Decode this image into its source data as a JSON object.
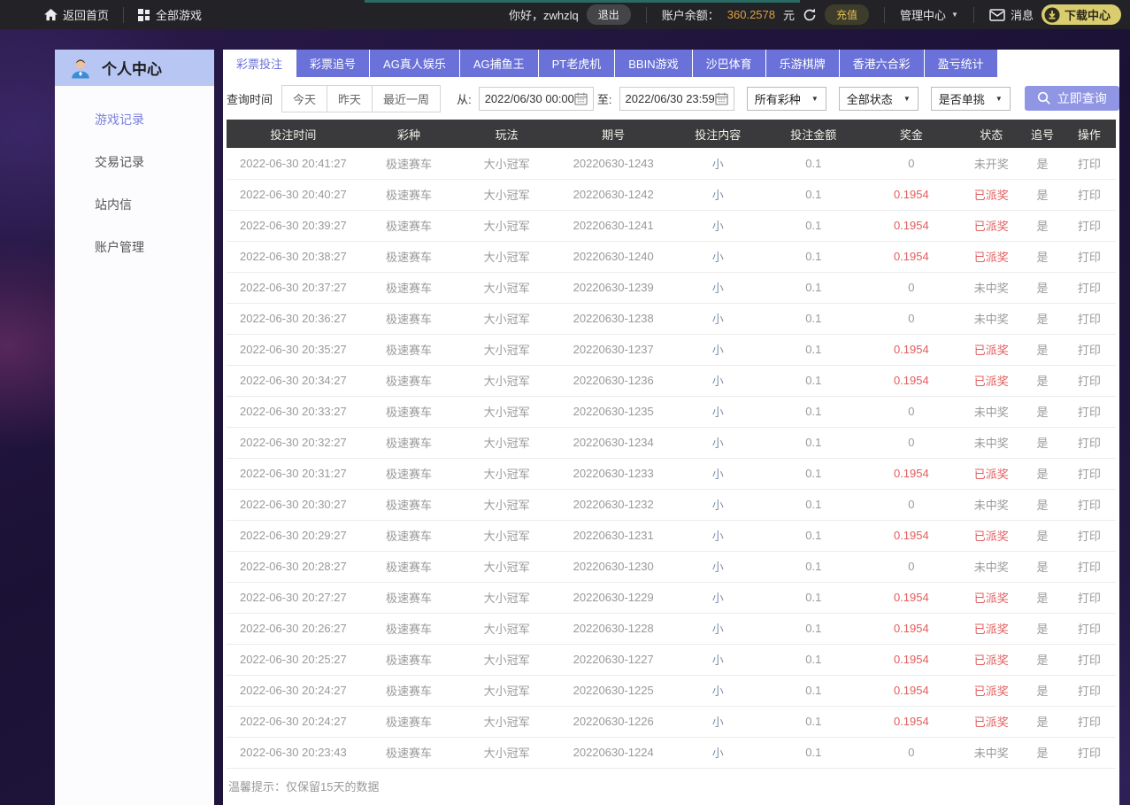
{
  "topbar": {
    "home_label": "返回首页",
    "all_games_label": "全部游戏",
    "greeting": "你好，zwhzlq",
    "logout_label": "退出",
    "balance_label": "账户余额：",
    "balance_value": "360.2578",
    "balance_unit": "元",
    "recharge_label": "充值",
    "admin_label": "管理中心",
    "messages_label": "消息",
    "download_label": "下载中心"
  },
  "sidebar": {
    "title": "个人中心",
    "items": [
      {
        "label": "游戏记录",
        "active": true
      },
      {
        "label": "交易记录",
        "active": false
      },
      {
        "label": "站内信",
        "active": false
      },
      {
        "label": "账户管理",
        "active": false
      }
    ]
  },
  "tabs": [
    {
      "label": "彩票投注",
      "active": true
    },
    {
      "label": "彩票追号",
      "active": false
    },
    {
      "label": "AG真人娱乐",
      "active": false
    },
    {
      "label": "AG捕鱼王",
      "active": false
    },
    {
      "label": "PT老虎机",
      "active": false
    },
    {
      "label": "BBIN游戏",
      "active": false
    },
    {
      "label": "沙巴体育",
      "active": false
    },
    {
      "label": "乐游棋牌",
      "active": false
    },
    {
      "label": "香港六合彩",
      "active": false
    },
    {
      "label": "盈亏统计",
      "active": false
    }
  ],
  "query": {
    "time_label": "查询时间",
    "quick_ranges": [
      "今天",
      "昨天",
      "最近一周"
    ],
    "from_label": "从:",
    "from_value": "2022/06/30 00:00",
    "to_label": "至:",
    "to_value": "2022/06/30 23:59",
    "filters": [
      "所有彩种",
      "全部状态",
      "是否单挑"
    ],
    "search_label": "立即查询"
  },
  "table": {
    "headers": [
      "投注时间",
      "彩种",
      "玩法",
      "期号",
      "投注内容",
      "投注金额",
      "奖金",
      "状态",
      "追号",
      "操作"
    ],
    "rows": [
      {
        "time": "2022-06-30 20:41:27",
        "lottery": "极速赛车",
        "play": "大小冠军",
        "issue": "20220630-1243",
        "content": "小",
        "amount": "0.1",
        "prize": "0",
        "status": "未开奖",
        "chase": "是",
        "action": "打印"
      },
      {
        "time": "2022-06-30 20:40:27",
        "lottery": "极速赛车",
        "play": "大小冠军",
        "issue": "20220630-1242",
        "content": "小",
        "amount": "0.1",
        "prize": "0.1954",
        "status": "已派奖",
        "chase": "是",
        "action": "打印"
      },
      {
        "time": "2022-06-30 20:39:27",
        "lottery": "极速赛车",
        "play": "大小冠军",
        "issue": "20220630-1241",
        "content": "小",
        "amount": "0.1",
        "prize": "0.1954",
        "status": "已派奖",
        "chase": "是",
        "action": "打印"
      },
      {
        "time": "2022-06-30 20:38:27",
        "lottery": "极速赛车",
        "play": "大小冠军",
        "issue": "20220630-1240",
        "content": "小",
        "amount": "0.1",
        "prize": "0.1954",
        "status": "已派奖",
        "chase": "是",
        "action": "打印"
      },
      {
        "time": "2022-06-30 20:37:27",
        "lottery": "极速赛车",
        "play": "大小冠军",
        "issue": "20220630-1239",
        "content": "小",
        "amount": "0.1",
        "prize": "0",
        "status": "未中奖",
        "chase": "是",
        "action": "打印"
      },
      {
        "time": "2022-06-30 20:36:27",
        "lottery": "极速赛车",
        "play": "大小冠军",
        "issue": "20220630-1238",
        "content": "小",
        "amount": "0.1",
        "prize": "0",
        "status": "未中奖",
        "chase": "是",
        "action": "打印"
      },
      {
        "time": "2022-06-30 20:35:27",
        "lottery": "极速赛车",
        "play": "大小冠军",
        "issue": "20220630-1237",
        "content": "小",
        "amount": "0.1",
        "prize": "0.1954",
        "status": "已派奖",
        "chase": "是",
        "action": "打印"
      },
      {
        "time": "2022-06-30 20:34:27",
        "lottery": "极速赛车",
        "play": "大小冠军",
        "issue": "20220630-1236",
        "content": "小",
        "amount": "0.1",
        "prize": "0.1954",
        "status": "已派奖",
        "chase": "是",
        "action": "打印"
      },
      {
        "time": "2022-06-30 20:33:27",
        "lottery": "极速赛车",
        "play": "大小冠军",
        "issue": "20220630-1235",
        "content": "小",
        "amount": "0.1",
        "prize": "0",
        "status": "未中奖",
        "chase": "是",
        "action": "打印"
      },
      {
        "time": "2022-06-30 20:32:27",
        "lottery": "极速赛车",
        "play": "大小冠军",
        "issue": "20220630-1234",
        "content": "小",
        "amount": "0.1",
        "prize": "0",
        "status": "未中奖",
        "chase": "是",
        "action": "打印"
      },
      {
        "time": "2022-06-30 20:31:27",
        "lottery": "极速赛车",
        "play": "大小冠军",
        "issue": "20220630-1233",
        "content": "小",
        "amount": "0.1",
        "prize": "0.1954",
        "status": "已派奖",
        "chase": "是",
        "action": "打印"
      },
      {
        "time": "2022-06-30 20:30:27",
        "lottery": "极速赛车",
        "play": "大小冠军",
        "issue": "20220630-1232",
        "content": "小",
        "amount": "0.1",
        "prize": "0",
        "status": "未中奖",
        "chase": "是",
        "action": "打印"
      },
      {
        "time": "2022-06-30 20:29:27",
        "lottery": "极速赛车",
        "play": "大小冠军",
        "issue": "20220630-1231",
        "content": "小",
        "amount": "0.1",
        "prize": "0.1954",
        "status": "已派奖",
        "chase": "是",
        "action": "打印"
      },
      {
        "time": "2022-06-30 20:28:27",
        "lottery": "极速赛车",
        "play": "大小冠军",
        "issue": "20220630-1230",
        "content": "小",
        "amount": "0.1",
        "prize": "0",
        "status": "未中奖",
        "chase": "是",
        "action": "打印"
      },
      {
        "time": "2022-06-30 20:27:27",
        "lottery": "极速赛车",
        "play": "大小冠军",
        "issue": "20220630-1229",
        "content": "小",
        "amount": "0.1",
        "prize": "0.1954",
        "status": "已派奖",
        "chase": "是",
        "action": "打印"
      },
      {
        "time": "2022-06-30 20:26:27",
        "lottery": "极速赛车",
        "play": "大小冠军",
        "issue": "20220630-1228",
        "content": "小",
        "amount": "0.1",
        "prize": "0.1954",
        "status": "已派奖",
        "chase": "是",
        "action": "打印"
      },
      {
        "time": "2022-06-30 20:25:27",
        "lottery": "极速赛车",
        "play": "大小冠军",
        "issue": "20220630-1227",
        "content": "小",
        "amount": "0.1",
        "prize": "0.1954",
        "status": "已派奖",
        "chase": "是",
        "action": "打印"
      },
      {
        "time": "2022-06-30 20:24:27",
        "lottery": "极速赛车",
        "play": "大小冠军",
        "issue": "20220630-1225",
        "content": "小",
        "amount": "0.1",
        "prize": "0.1954",
        "status": "已派奖",
        "chase": "是",
        "action": "打印"
      },
      {
        "time": "2022-06-30 20:24:27",
        "lottery": "极速赛车",
        "play": "大小冠军",
        "issue": "20220630-1226",
        "content": "小",
        "amount": "0.1",
        "prize": "0.1954",
        "status": "已派奖",
        "chase": "是",
        "action": "打印"
      },
      {
        "time": "2022-06-30 20:23:43",
        "lottery": "极速赛车",
        "play": "大小冠军",
        "issue": "20220630-1224",
        "content": "小",
        "amount": "0.1",
        "prize": "0",
        "status": "未中奖",
        "chase": "是",
        "action": "打印"
      }
    ]
  },
  "footer_note": "温馨提示：仅保留15天的数据",
  "colors": {
    "accent_purple": "#6a71d8",
    "table_header_bg": "#3a3a3c",
    "win_red": "#e25d5d",
    "balance_orange": "#dd9f3d",
    "download_yellow": "#d9cd70",
    "sidebar_header_blue": "#b7c6f2",
    "bet_content_blue": "#7b8fa8"
  }
}
